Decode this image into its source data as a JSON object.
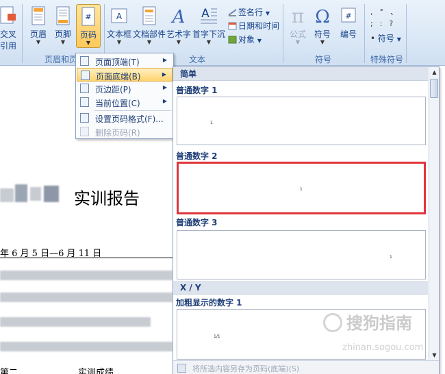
{
  "ribbon": {
    "partial_button_line1": "交叉",
    "partial_button_line2": "引用",
    "header_btn": "页眉",
    "footer_btn": "页脚",
    "pagenum_btn": "页码",
    "textbox_btn": "文本框",
    "quickparts_btn": "文档部件",
    "wordart_btn": "艺术字",
    "dropcap_btn": "首字下沉",
    "signature_line": "签名行",
    "datetime": "日期和时间",
    "object": "对象",
    "equation_btn": "公式",
    "symbol_btn": "符号",
    "number_btn": "编号",
    "special_symbol_btn": "符号",
    "group_headerfooter": "页眉和页",
    "group_text": "文本",
    "group_symbols": "符号",
    "group_special": "特殊符号"
  },
  "menu": {
    "items": [
      {
        "label": "页面顶端(T)"
      },
      {
        "label": "页面底端(B)"
      },
      {
        "label": "页边距(P)"
      },
      {
        "label": "当前位置(C)"
      },
      {
        "label": "设置页码格式(F)..."
      },
      {
        "label": "删除页码(R)"
      }
    ]
  },
  "gallery": {
    "section_simple": "简单",
    "item1": "普通数字 1",
    "item2": "普通数字 2",
    "item3": "普通数字 3",
    "section_xy": "X / Y",
    "item4": "加粗显示的数字 1",
    "thumb4_text": "1/1",
    "footer_label": "将所选内容另存为页码(底端)(S)"
  },
  "document": {
    "title": "实训报告",
    "date_line": "年 6 月 5 日—6 月 11 日",
    "bottom_left": "第二",
    "bottom_right": "实训成绩"
  },
  "watermark": {
    "line1": "搜狗指南",
    "line2": "zhinan.sogou.com"
  },
  "colors": {
    "ribbon_text": "#15428b",
    "highlight": "#ffd36e",
    "selection_border": "#e0343a"
  }
}
